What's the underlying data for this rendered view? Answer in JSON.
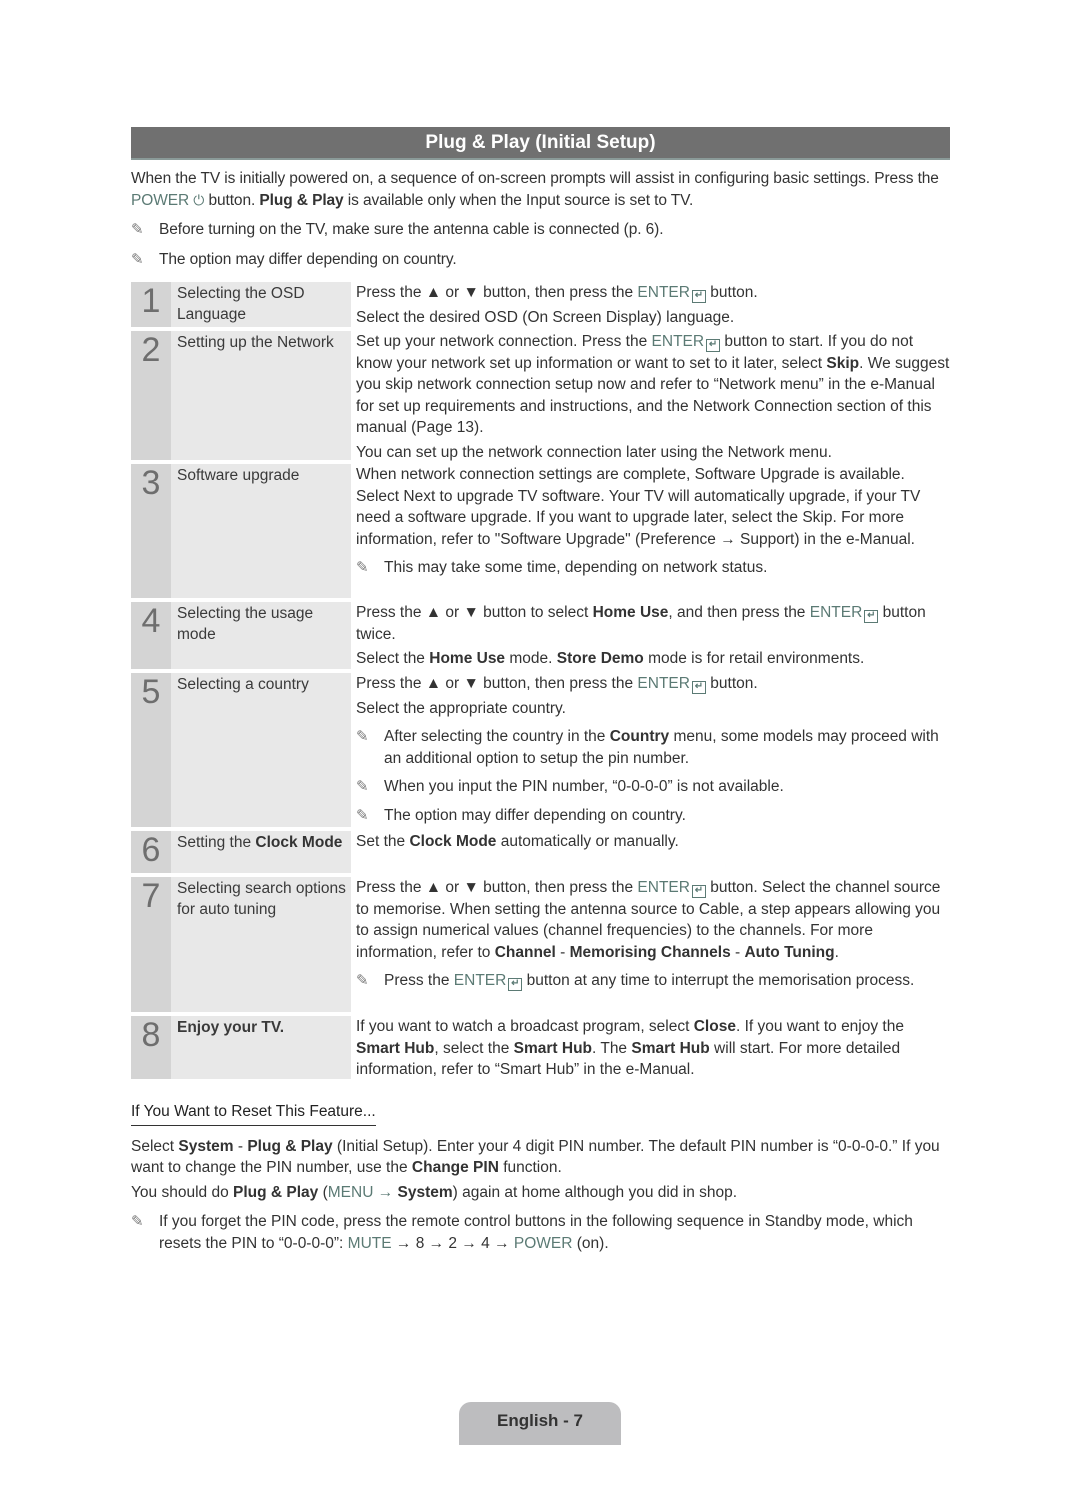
{
  "title": "Plug & Play (Initial Setup)",
  "intro": {
    "line1": "When the TV is initially powered on, a sequence of on-screen prompts will assist in configuring basic settings.",
    "line2_pre": "Press the ",
    "line2_power": "POWER",
    "line2_power_icon": "power-icon",
    "line2_mid": " button. ",
    "line2_bold": "Plug & Play",
    "line2_post": " is available only when the Input source is set to TV.",
    "notes": [
      "Before turning on the TV, make sure the antenna cable is connected (p. 6).",
      "The option may differ depending on country."
    ]
  },
  "common": {
    "enter": "ENTER",
    "enter_icon": "↵",
    "pencil_icon": "✎",
    "arrows": "Press the ▲ or ▼ button, then press the ",
    "button_suffix": " button."
  },
  "steps": [
    {
      "number": "1",
      "label": "Selecting the OSD Language",
      "desc": {
        "line1_post": " button.",
        "line2": "Select the desired OSD (On Screen Display) language."
      }
    },
    {
      "number": "2",
      "label": "Setting up the Network",
      "desc": {
        "pre": "Set up your network connection. Press the ",
        "post": " button to start. If you do not know your network set up information or want to set to it later, select ",
        "skip": "Skip",
        "rest": ". We suggest you skip network connection setup now and refer to “Network menu” in the e-Manual for set up requirements and instructions, and the Network Connection section of this manual (Page 13).",
        "line2": "You can set up the network connection later using the Network menu."
      }
    },
    {
      "number": "3",
      "label": "Software upgrade",
      "desc": {
        "text": "When network connection settings are complete, Software Upgrade is available. Select Next to upgrade TV software. Your TV will automatically upgrade, if your TV need a software upgrade. If you want to upgrade later, select the Skip. For more information, refer to \"Software Upgrade\" (Preference → Support) in the e-Manual.",
        "note": "This may take some time, depending on network status."
      }
    },
    {
      "number": "4",
      "label": "Selecting the usage mode",
      "desc": {
        "pre": "Press the ▲ or ▼ button to select ",
        "home_use": "Home Use",
        "mid": ", and then press the ",
        "post": " button twice.",
        "line2_pre": "Select the ",
        "line2_home": "Home Use",
        "line2_mid": " mode. ",
        "line2_store": "Store Demo",
        "line2_post": " mode is for retail environments."
      }
    },
    {
      "number": "5",
      "label": "Selecting a country",
      "desc": {
        "line2": "Select the appropriate country.",
        "note1_pre": "After selecting the country in the ",
        "note1_bold": "Country",
        "note1_post": " menu, some models may proceed with an additional option to setup the pin number.",
        "note2": "When you input the PIN number, “0-0-0-0” is not available.",
        "note3": "The option may differ depending on country."
      }
    },
    {
      "number": "6",
      "label_pre": "Setting the ",
      "label_bold": "Clock Mode",
      "desc": {
        "pre": "Set the ",
        "bold": "Clock Mode",
        "post": " automatically or manually."
      }
    },
    {
      "number": "7",
      "label": "Selecting search options for auto tuning",
      "desc": {
        "post": " button. Select the channel source to memorise. When setting the antenna source to Cable, a step appears allowing you to assign numerical values (channel frequencies) to the channels. For more information, refer to ",
        "b1": "Channel",
        "sep": " - ",
        "b2": "Memorising Channels",
        "b3": "Auto Tuning",
        "end": ".",
        "note_pre": "Press the ",
        "note_post": " button at any time to interrupt the memorisation process."
      }
    },
    {
      "number": "8",
      "label": "Enjoy your TV.",
      "desc": {
        "pre": "If you want to watch a broadcast program, select ",
        "close": "Close",
        "mid1": ". If you want to enjoy the ",
        "smart_hub": "Smart Hub",
        "mid2": ", select the ",
        "mid3": ". The ",
        "post": " will start. For more detailed information, refer to “Smart Hub” in the e-Manual."
      }
    }
  ],
  "reset": {
    "title": "If You Want to Reset This Feature...",
    "p1_pre": "Select ",
    "p1_system": "System",
    "p1_sep": " - ",
    "p1_pnp": "Plug & Play",
    "p1_post": " (Initial Setup). Enter your 4 digit PIN number. The default PIN number is “0-0-0-0.” If you want to change the PIN number, use the ",
    "p1_change": "Change PIN",
    "p1_end": " function.",
    "p2_pre": "You should do ",
    "p2_pnp": "Plug & Play",
    "p2_open": " (",
    "p2_menu": "MENU →",
    "p2_space": " ",
    "p2_system": "System",
    "p2_post": ") again at home although you did in shop.",
    "note_pre": "If you forget the PIN code, press the remote control buttons in the following sequence in Standby mode, which resets the PIN to “0-0-0-0”: ",
    "note_mute": "MUTE",
    "note_seq": " → 8 → 2 → 4 → ",
    "note_power": "POWER",
    "note_end": " (on)."
  },
  "footer": {
    "page_label": "English - 7"
  },
  "colors": {
    "title_bar": "#707070",
    "highlight": "#5b7a74",
    "number_col": "#d4d4d4",
    "label_col": "#e8e8e8",
    "footer_tab": "#bdbdbf"
  }
}
